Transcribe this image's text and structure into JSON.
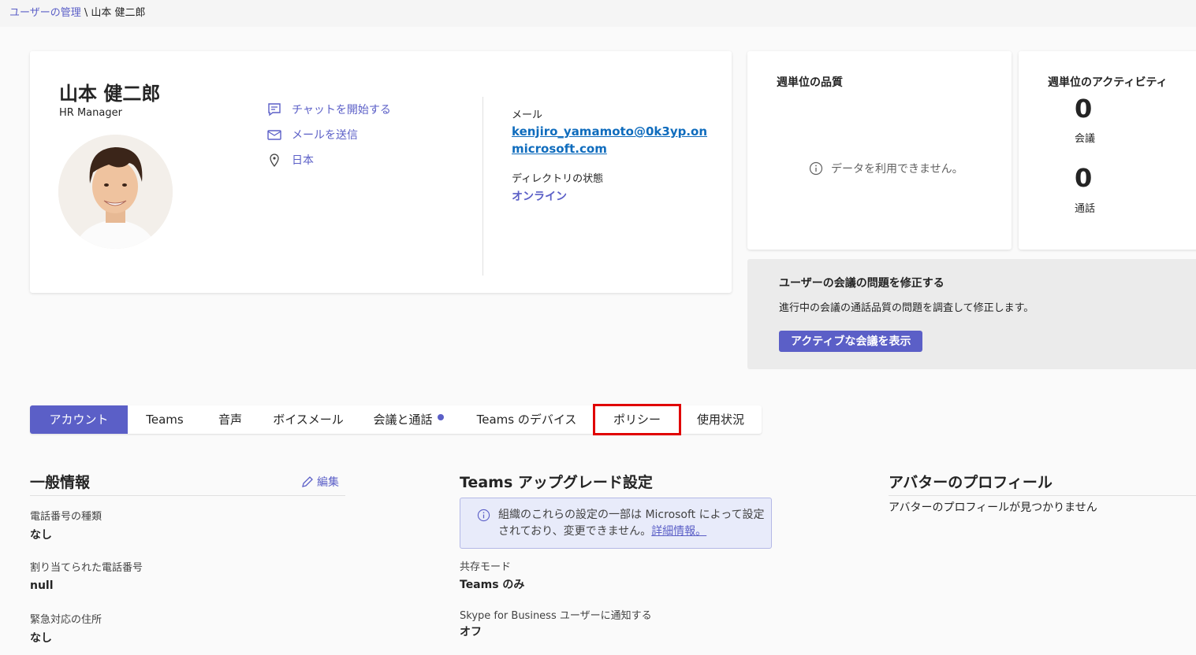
{
  "breadcrumb": {
    "parent": "ユーザーの管理",
    "separator": "\\",
    "current": "山本 健二郎"
  },
  "profile": {
    "name": "山本 健二郎",
    "job_title": "HR Manager",
    "actions": [
      {
        "label": "チャットを開始する",
        "icon": "chat-icon"
      },
      {
        "label": "メールを送信",
        "icon": "mail-icon"
      },
      {
        "label": "日本",
        "icon": "location-icon"
      }
    ],
    "email_label": "メール",
    "email": "kenjiro_yamamoto@0k3yp.onmicrosoft.com",
    "directory_label": "ディレクトリの状態",
    "directory_status": "オンライン"
  },
  "quality": {
    "title": "週単位の品質",
    "no_data": "データを利用できません。"
  },
  "activity": {
    "title": "週単位のアクティビティ",
    "meetings_count": "0",
    "meetings_label": "会議",
    "calls_count": "0",
    "calls_label": "通話"
  },
  "fix": {
    "title": "ユーザーの会議の問題を修正する",
    "description": "進行中の会議の通話品質の問題を調査して修正します。",
    "button": "アクティブな会議を表示"
  },
  "tabs": [
    {
      "label": "アカウント",
      "active": true
    },
    {
      "label": "Teams"
    },
    {
      "label": "音声"
    },
    {
      "label": "ボイスメール"
    },
    {
      "label": "会議と通話",
      "dot": true
    },
    {
      "label": "Teams のデバイス"
    },
    {
      "label": "ポリシー",
      "highlighted": true
    },
    {
      "label": "使用状況"
    }
  ],
  "general": {
    "title": "一般情報",
    "edit": "編集",
    "fields": [
      {
        "label": "電話番号の種類",
        "value": "なし"
      },
      {
        "label": "割り当てられた電話番号",
        "value": "null"
      },
      {
        "label": "緊急対応の住所",
        "value": "なし"
      }
    ]
  },
  "upgrade": {
    "title": "Teams アップグレード設定",
    "info_text": "組織のこれらの設定の一部は Microsoft によって設定されており、変更できません。",
    "info_link": "詳細情報。",
    "fields": [
      {
        "label": "共存モード",
        "value": "Teams のみ"
      },
      {
        "label": "Skype for Business ユーザーに通知する",
        "value": "オフ"
      }
    ]
  },
  "avatar_profile": {
    "title": "アバターのプロフィール",
    "message": "アバターのプロフィールが見つかりません"
  },
  "colors": {
    "accent": "#5b5fc7",
    "link": "#0f6cbd",
    "highlight": "#e00000"
  }
}
